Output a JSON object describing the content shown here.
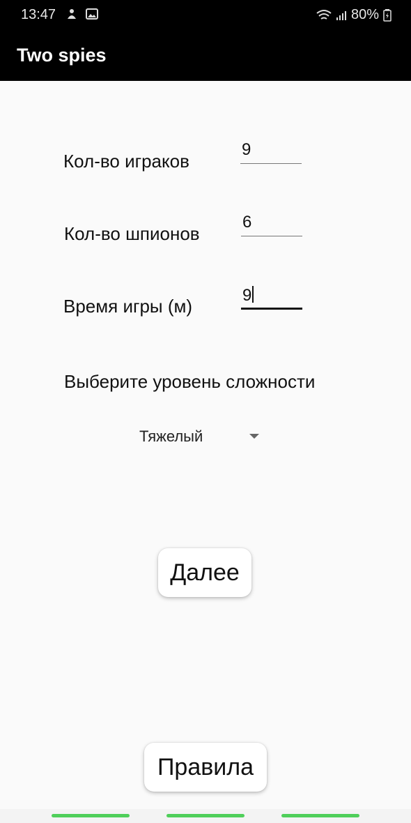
{
  "status_bar": {
    "time": "13:47",
    "battery": "80%",
    "icons": [
      "notification-icon",
      "image-icon",
      "wifi-icon",
      "signal-icon",
      "battery-icon"
    ]
  },
  "app_bar": {
    "title": "Two spies"
  },
  "form": {
    "players": {
      "label": "Кол-во играков",
      "value": "9"
    },
    "spies": {
      "label": "Кол-во шпионов",
      "value": "6"
    },
    "time": {
      "label": "Время игры (м)",
      "value": "9"
    },
    "difficulty_prompt": "Выберите уровень сложности",
    "difficulty_selected": "Тяжелый"
  },
  "buttons": {
    "next": "Далее",
    "rules": "Правила"
  },
  "colors": {
    "accent_nav": "#4fcf5a",
    "bar": "#000000",
    "background": "#fafafa"
  }
}
